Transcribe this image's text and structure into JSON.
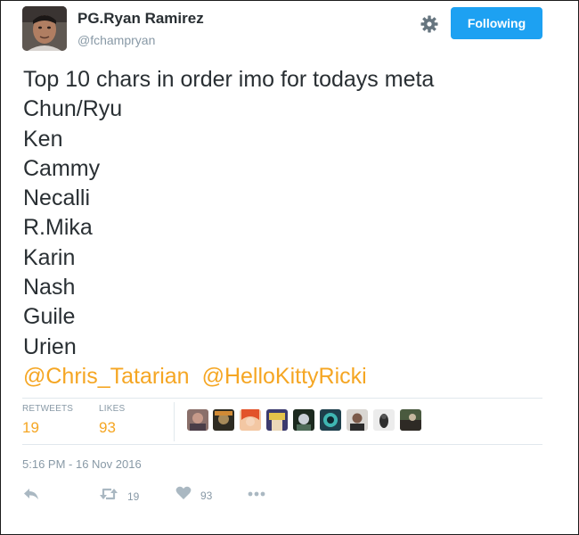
{
  "user": {
    "display_name": "PG.Ryan Ramirez",
    "handle": "@fchampryan"
  },
  "header": {
    "follow_label": "Following",
    "gear_icon": "gear-icon"
  },
  "tweet": {
    "lines": [
      "Top 10 chars in order imo for todays meta",
      "Chun/Ryu",
      "Ken",
      "Cammy",
      "Necalli",
      "R.Mika",
      "Karin",
      "Nash",
      "Guile",
      "Urien"
    ],
    "mentions": [
      "@Chris_Tatarian",
      "@HelloKittyRicki"
    ]
  },
  "stats": {
    "retweets_label": "RETWEETS",
    "retweets_value": "19",
    "likes_label": "LIKES",
    "likes_value": "93"
  },
  "timestamp": "5:16 PM - 16 Nov 2016",
  "actions": {
    "reply_icon": "reply-icon",
    "retweet_icon": "retweet-icon",
    "retweet_count": "19",
    "like_icon": "heart-icon",
    "like_count": "93",
    "more_icon": "more-icon"
  },
  "colors": {
    "accent": "#1da1f2",
    "link": "#f5a623",
    "muted": "#8899a6",
    "text": "#292f33"
  }
}
